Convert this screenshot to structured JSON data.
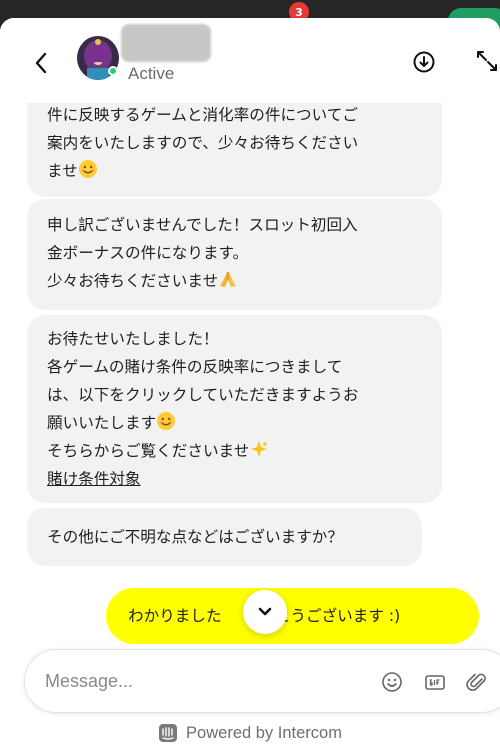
{
  "background": {
    "notification_count": "3"
  },
  "header": {
    "status": "Active",
    "icons": {
      "back": "chevron-left-icon",
      "download": "download-circle-icon",
      "expand": "expand-arrows-icon"
    }
  },
  "messages": [
    {
      "from": "agent",
      "lines": [
        "件に反映するゲームと消化率の件についてご",
        "案内をいたしますので、少々お待ちください",
        "ませ"
      ],
      "emoji": "smiling-face"
    },
    {
      "from": "agent",
      "lines": [
        "申し訳ございませんでした！スロット初回入",
        "金ボーナスの件になります。",
        "少々お待ちくださいませ"
      ],
      "emoji": "folded-hands"
    },
    {
      "from": "agent",
      "lines": [
        "お待たせいたしました！",
        "各ゲームの賭け条件の反映率につきまして",
        "は、以下をクリックしていただきますようお",
        "願いいたします",
        "そちらからご覧くださいませ"
      ],
      "emojis": [
        "smiling-face",
        "sparkles"
      ],
      "link_text": "賭け条件対象"
    },
    {
      "from": "agent",
      "lines": [
        "その他にご不明な点などはございますか？"
      ]
    },
    {
      "from": "user",
      "text_left": "わかりました",
      "text_right": "りがとうございます :)"
    }
  ],
  "composer": {
    "placeholder": "Message..."
  },
  "footer": {
    "powered_by": "Powered by Intercom"
  },
  "colors": {
    "user_bubble": "#ffff00",
    "agent_bubble": "#f2f2f2",
    "online": "#2ecc71"
  }
}
